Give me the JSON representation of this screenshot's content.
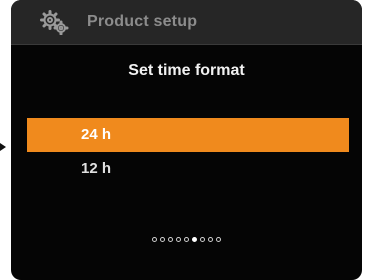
{
  "header": {
    "icon": "gears-icon",
    "title": "Product setup"
  },
  "screen": {
    "subtitle": "Set time format"
  },
  "options": [
    {
      "label": "24 h",
      "selected": true
    },
    {
      "label": "12 h",
      "selected": false
    }
  ],
  "pagination": {
    "total": 9,
    "active_index": 5
  },
  "colors": {
    "accent": "#f08a1d",
    "screen_background": "#050505",
    "header_background": "#262626",
    "header_text": "#8c8c8c"
  }
}
